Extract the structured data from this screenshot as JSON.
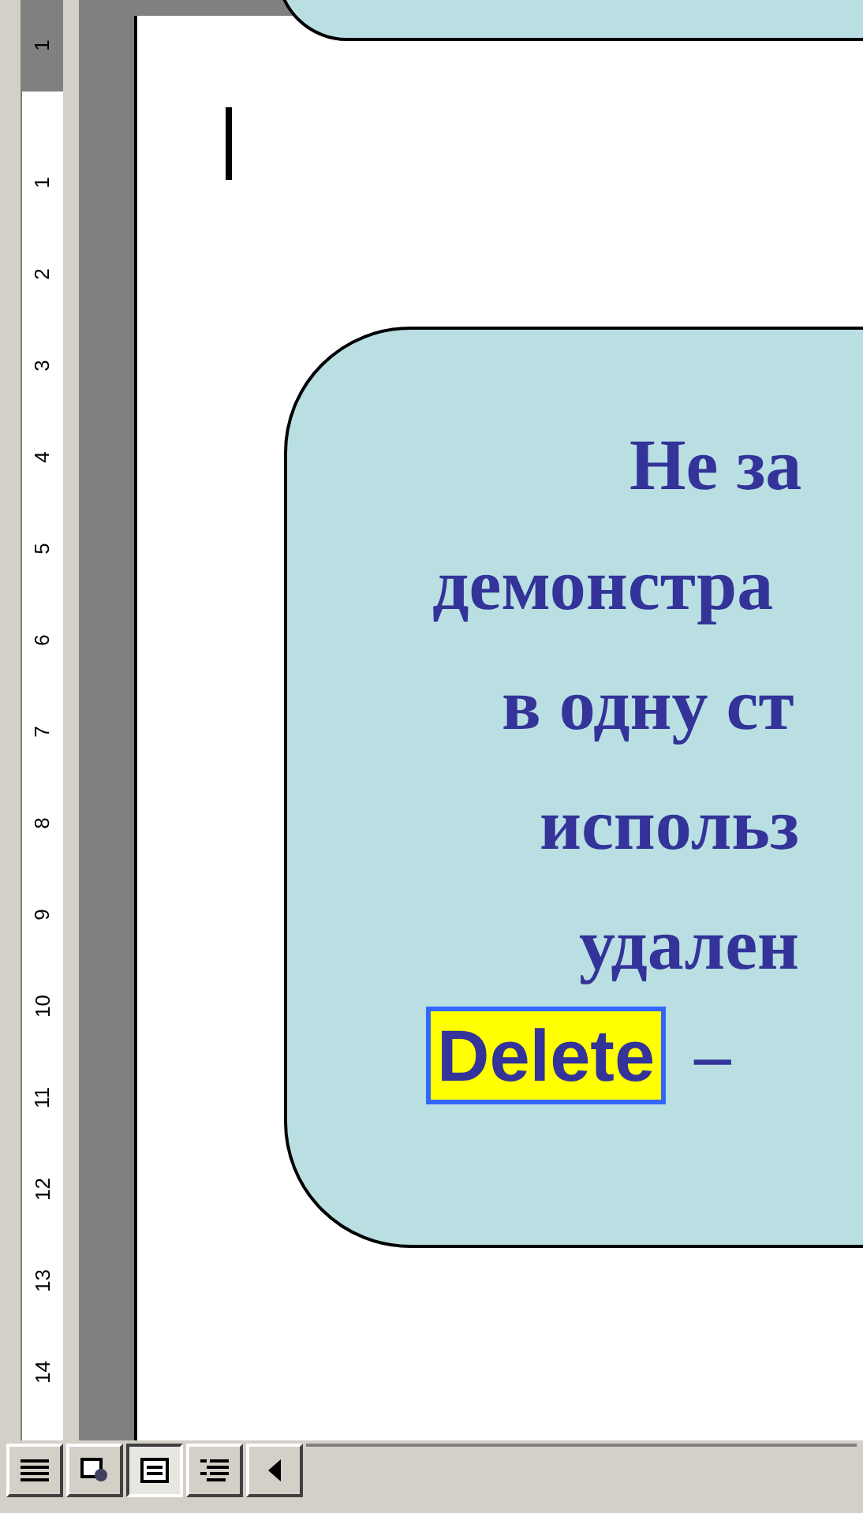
{
  "ruler": {
    "labels": [
      "1",
      "1",
      "2",
      "3",
      "4",
      "5",
      "6",
      "7",
      "8",
      "9",
      "10",
      "11",
      "12",
      "13",
      "14"
    ]
  },
  "callout": {
    "lines": [
      "Не за",
      "демонстра",
      "в одну ст",
      "использ",
      "удален"
    ],
    "key": "Delete",
    "after_key": "–"
  },
  "view_buttons": [
    {
      "kind": "normal",
      "selected": false
    },
    {
      "kind": "web",
      "selected": false
    },
    {
      "kind": "print",
      "selected": true
    },
    {
      "kind": "outline",
      "selected": false
    }
  ]
}
